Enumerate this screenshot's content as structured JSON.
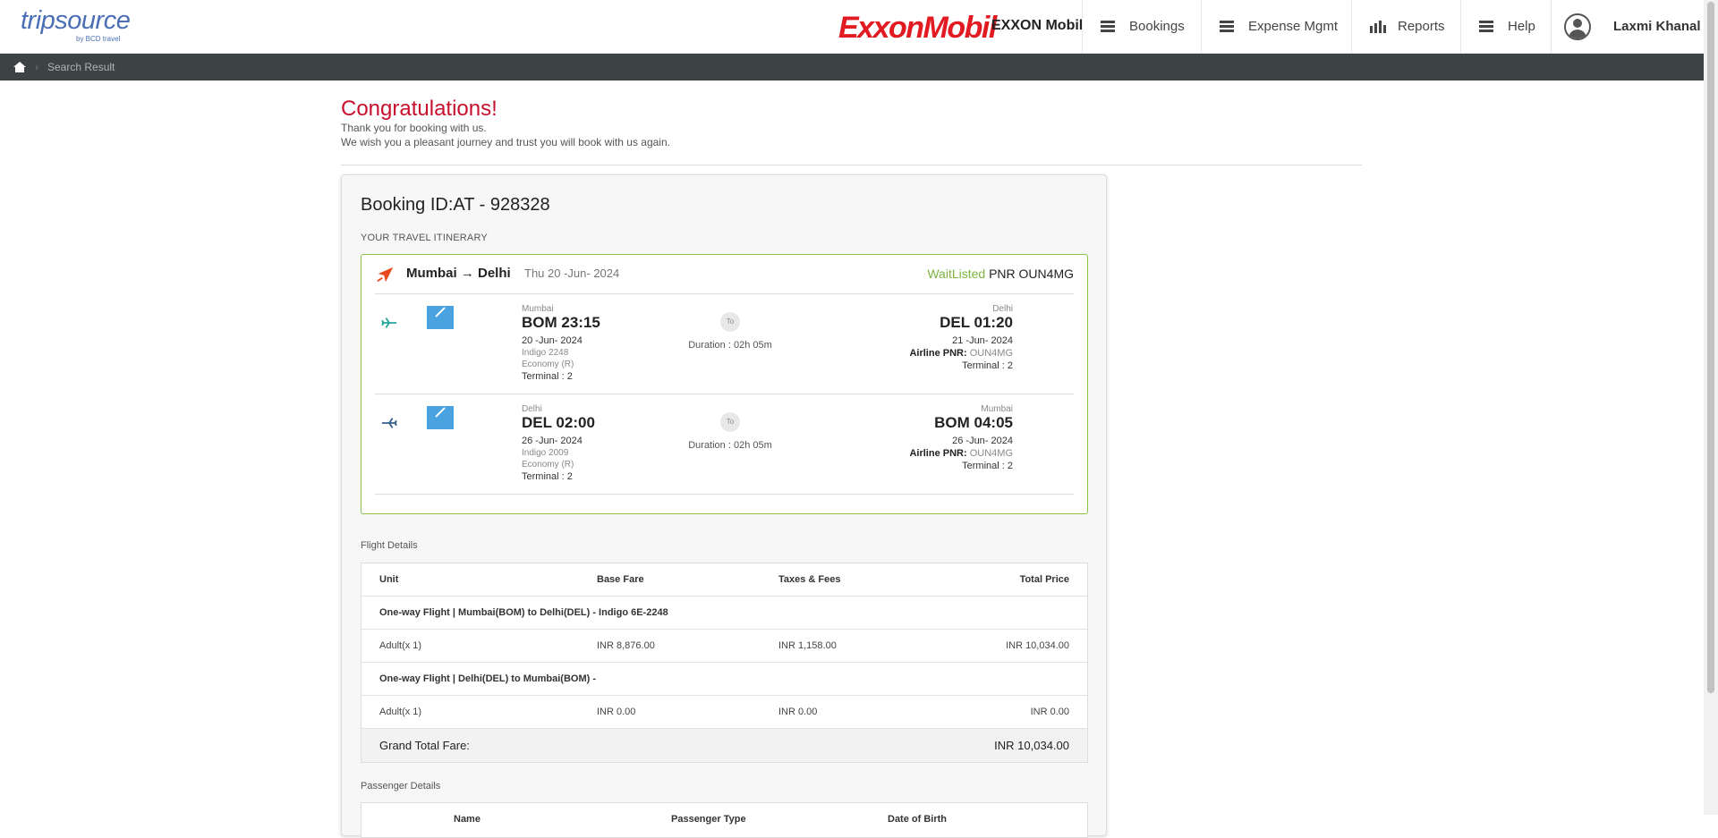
{
  "header": {
    "logo_text": "tripsource",
    "logo_sub": "by BCD travel",
    "brand": "ExxonMobil",
    "company": "EXXON Mobil",
    "nav": [
      {
        "label": "Bookings"
      },
      {
        "label": "Expense Mgmt"
      },
      {
        "label": "Reports"
      },
      {
        "label": "Help"
      }
    ],
    "user": "Laxmi Khanal"
  },
  "breadcrumb": {
    "current": "Search Result"
  },
  "confirmation": {
    "title": "Congratulations!",
    "line1": "Thank you for booking with us.",
    "line2": "We wish you a pleasant journey and trust you will book with us again."
  },
  "booking": {
    "id_label": "Booking ID:AT - 928328",
    "itinerary_label": "YOUR TRAVEL ITINERARY",
    "route": "Mumbai → Delhi",
    "route_date": "Thu 20 -Jun- 2024",
    "status": "WaitListed",
    "pnr": "PNR OUN4MG",
    "legs": [
      {
        "dep_city": "Mumbai",
        "dep_time": "BOM 23:15",
        "dep_date": "20 -Jun- 2024",
        "flight": "Indigo 2248",
        "cabin": "Economy (R)",
        "dep_terminal": "Terminal :  2",
        "to": "To",
        "duration": "Duration : 02h 05m",
        "arr_city": "Delhi",
        "arr_time": "DEL 01:20",
        "arr_date": "21 -Jun- 2024",
        "airline_pnr_label": "Airline PNR:",
        "airline_pnr": "OUN4MG",
        "arr_terminal": "Terminal :  2"
      },
      {
        "dep_city": "Delhi",
        "dep_time": "DEL 02:00",
        "dep_date": "26 -Jun- 2024",
        "flight": "Indigo 2009",
        "cabin": "Economy (R)",
        "dep_terminal": "Terminal :  2",
        "to": "To",
        "duration": "Duration : 02h 05m",
        "arr_city": "Mumbai",
        "arr_time": "BOM 04:05",
        "arr_date": "26 -Jun- 2024",
        "airline_pnr_label": "Airline PNR:",
        "airline_pnr": "OUN4MG",
        "arr_terminal": "Terminal :  2"
      }
    ]
  },
  "fare": {
    "section_label": "Flight Details",
    "headers": [
      "Unit",
      "Base Fare",
      "Taxes & Fees",
      "Total Price"
    ],
    "rows": [
      {
        "segment": "One-way Flight | Mumbai(BOM) to Delhi(DEL) - Indigo 6E-2248"
      },
      {
        "unit": "Adult(x 1)",
        "base": "INR 8,876.00",
        "taxes": "INR 1,158.00",
        "total": "INR 10,034.00"
      },
      {
        "segment": "One-way Flight | Delhi(DEL) to Mumbai(BOM) -"
      },
      {
        "unit": "Adult(x 1)",
        "base": "INR 0.00",
        "taxes": "INR 0.00",
        "total": "INR 0.00"
      }
    ],
    "grand_label": "Grand Total Fare:",
    "grand_value": "INR 10,034.00"
  },
  "passenger": {
    "section_label": "Passenger Details",
    "headers": [
      "Name",
      "Passenger Type",
      "Date of Birth"
    ]
  },
  "colors": {
    "accent_red": "#c8102e",
    "status_green": "#7cb342",
    "dark_bar": "#3d4245"
  }
}
